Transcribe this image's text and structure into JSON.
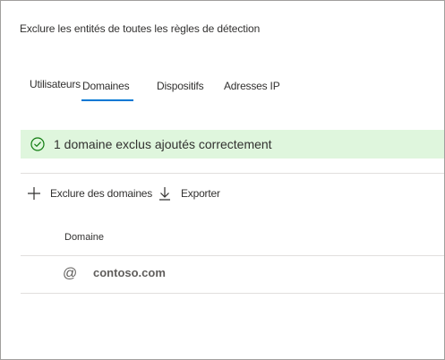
{
  "panel": {
    "title": "Exclure les entités de toutes les règles de détection"
  },
  "tabs": [
    {
      "label": "Utilisateurs",
      "selected": false
    },
    {
      "label": "Domaines",
      "selected": true
    },
    {
      "label": "Dispositifs",
      "selected": false
    },
    {
      "label": "Adresses IP",
      "selected": false
    }
  ],
  "banner": {
    "icon": "checkmark-circle-icon",
    "text": "1 domaine exclus ajoutés correctement",
    "color": "#dff6dd"
  },
  "toolbar": {
    "add_label": "Exclure des domaines",
    "add_icon": "plus-icon",
    "export_label": "Exporter",
    "export_icon": "download-icon"
  },
  "table": {
    "columns": [
      "Domaine"
    ],
    "rows": [
      {
        "icon": "at-icon",
        "icon_glyph": "@",
        "domain": "contoso.com"
      }
    ]
  },
  "colors": {
    "accent": "#0078d4",
    "success_bg": "#dff6dd",
    "success_icon": "#107c10"
  }
}
